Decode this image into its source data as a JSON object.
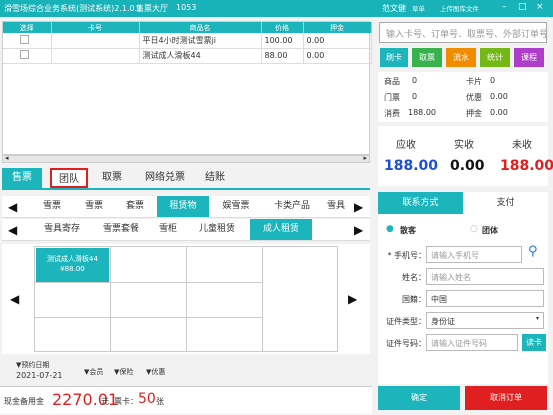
{
  "window": {
    "title": "滑雪场综合业务系统(测试系统)2.1.0.1",
    "hall": "售票大厅",
    "hall_code": "1053",
    "user": "范文健",
    "links": [
      "草单",
      "上传图库文件"
    ],
    "controls": [
      "–",
      "□",
      "×"
    ]
  },
  "grid": {
    "headers": [
      "选择",
      "卡号",
      "商品名",
      "价格",
      "押金"
    ],
    "rows": [
      {
        "card": "",
        "name": "平日4小时测试雪票ji",
        "price": "100.00",
        "deposit": "0.00"
      },
      {
        "card": "",
        "name": "测试成人滑板44",
        "price": "88.00",
        "deposit": "0.00"
      }
    ]
  },
  "main_tabs": [
    "售票",
    "团队",
    "取票",
    "网络兑票",
    "结账"
  ],
  "category_row1": [
    "雪票",
    "雪票",
    "套票",
    "租赁物",
    "娱雪票",
    "卡类产品",
    "雪具"
  ],
  "category_row2": [
    "雪具寄存",
    "雪票套餐",
    "雪柜",
    "儿童租赁",
    "成人租赁"
  ],
  "product": {
    "name": "测试成人滑板44",
    "price": "¥88.00"
  },
  "filters": {
    "date_label": "▼预约日期",
    "date": "2021-07-21",
    "member": "▼会员",
    "insurance": "▼保险",
    "discount": "▼优惠"
  },
  "footer": {
    "cash_label": "现金备用金",
    "cash": "2270.01",
    "cash_unit": "元",
    "ticket_label": "票卡：",
    "tickets": "50",
    "ticket_unit": "张"
  },
  "search": {
    "placeholder": "输入卡号、订单号、取票号、外部订单号"
  },
  "actions": [
    {
      "label": "刷卡",
      "color": "#1cb5bc"
    },
    {
      "label": "取票",
      "color": "#37b24d"
    },
    {
      "label": "流水",
      "color": "#f08c00"
    },
    {
      "label": "统计",
      "color": "#74b816"
    },
    {
      "label": "课程",
      "color": "#ae3ec9"
    }
  ],
  "stats": {
    "goods_label": "商品",
    "goods": "0",
    "card_label": "卡片",
    "card": "0",
    "ticket_label": "门票",
    "ticket": "0",
    "discount_label": "优惠",
    "discount": "0.00",
    "consume_label": "消费",
    "consume": "188.00",
    "deposit_label": "押金",
    "deposit": "0.00"
  },
  "amounts": {
    "due_label": "应收",
    "due": "188.00",
    "paid_label": "实收",
    "paid": "0.00",
    "unpaid_label": "未收",
    "unpaid": "188.00"
  },
  "panel_tabs": [
    "联系方式",
    "支付"
  ],
  "customer_type": {
    "selected": "散客",
    "other": "团体"
  },
  "form": {
    "phone_label": "* 手机号：",
    "phone_placeholder": "请输入手机号",
    "name_label": "姓名：",
    "name_placeholder": "请输入姓名",
    "nation_label": "国籍：",
    "nation": "中国",
    "id_type_label": "证件类型：",
    "id_type": "身份证",
    "id_no_label": "证件号码：",
    "id_no_placeholder": "请输入证件号码",
    "read_card": "读卡"
  },
  "confirm_label": "确定",
  "cancel_label": "取消订单"
}
